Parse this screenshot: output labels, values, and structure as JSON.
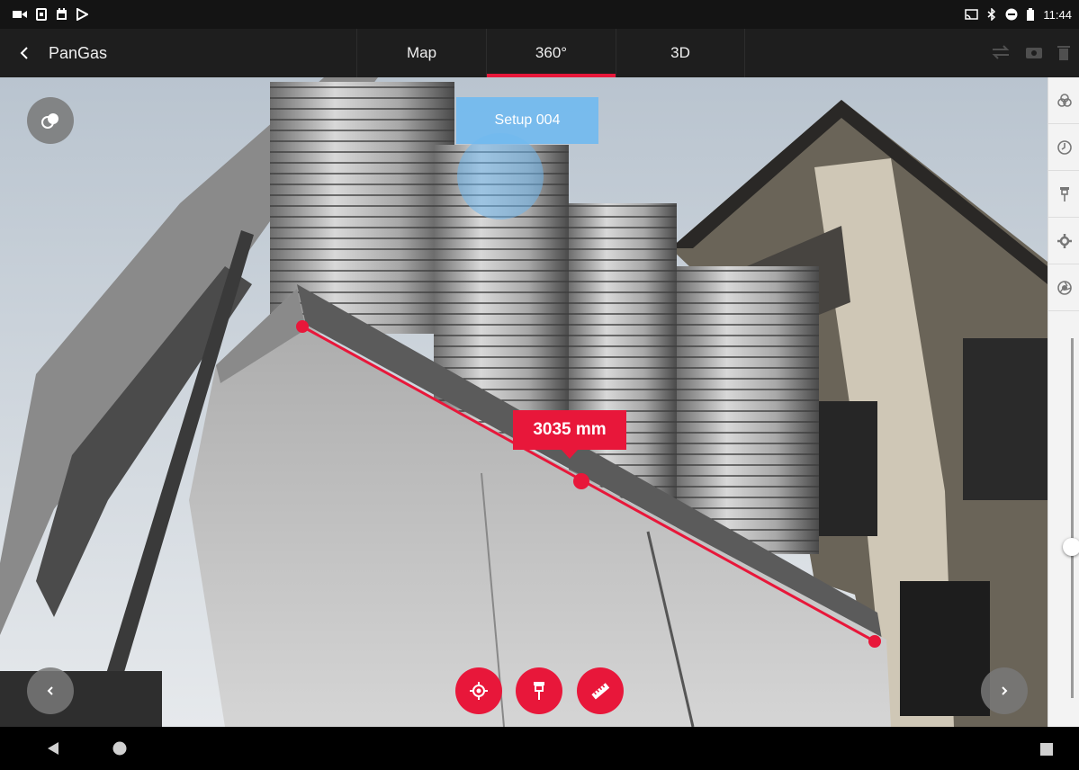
{
  "status_bar": {
    "time": "11:44",
    "left_icons": [
      "video-icon",
      "sim-icon",
      "calendar-icon",
      "play-store-icon"
    ],
    "right_icons": [
      "cast-icon",
      "bluetooth-icon",
      "do-not-disturb-icon",
      "battery-icon"
    ]
  },
  "app_bar": {
    "title": "PanGas",
    "tabs": [
      {
        "label": "Map",
        "active": false
      },
      {
        "label": "360°",
        "active": true
      },
      {
        "label": "3D",
        "active": false
      }
    ],
    "action_icons": [
      "swap-icon",
      "camera-icon",
      "delete-icon"
    ]
  },
  "viewer": {
    "setup_label": "Setup 004",
    "measurement": {
      "value": "3035 mm"
    },
    "tools": [
      "target-icon",
      "pin-icon",
      "ruler-icon"
    ],
    "nav_icons": [
      "chevron-left-icon",
      "chevron-right-icon"
    ]
  },
  "right_rail": {
    "icons": [
      "layers-icon",
      "clock-icon",
      "pin-icon",
      "settings-icon",
      "aperture-icon"
    ],
    "slider_level": 0.42
  },
  "colors": {
    "accent": "#e8173a",
    "setup_blue": "#70b9f0",
    "appbar": "#1e1e1e"
  }
}
